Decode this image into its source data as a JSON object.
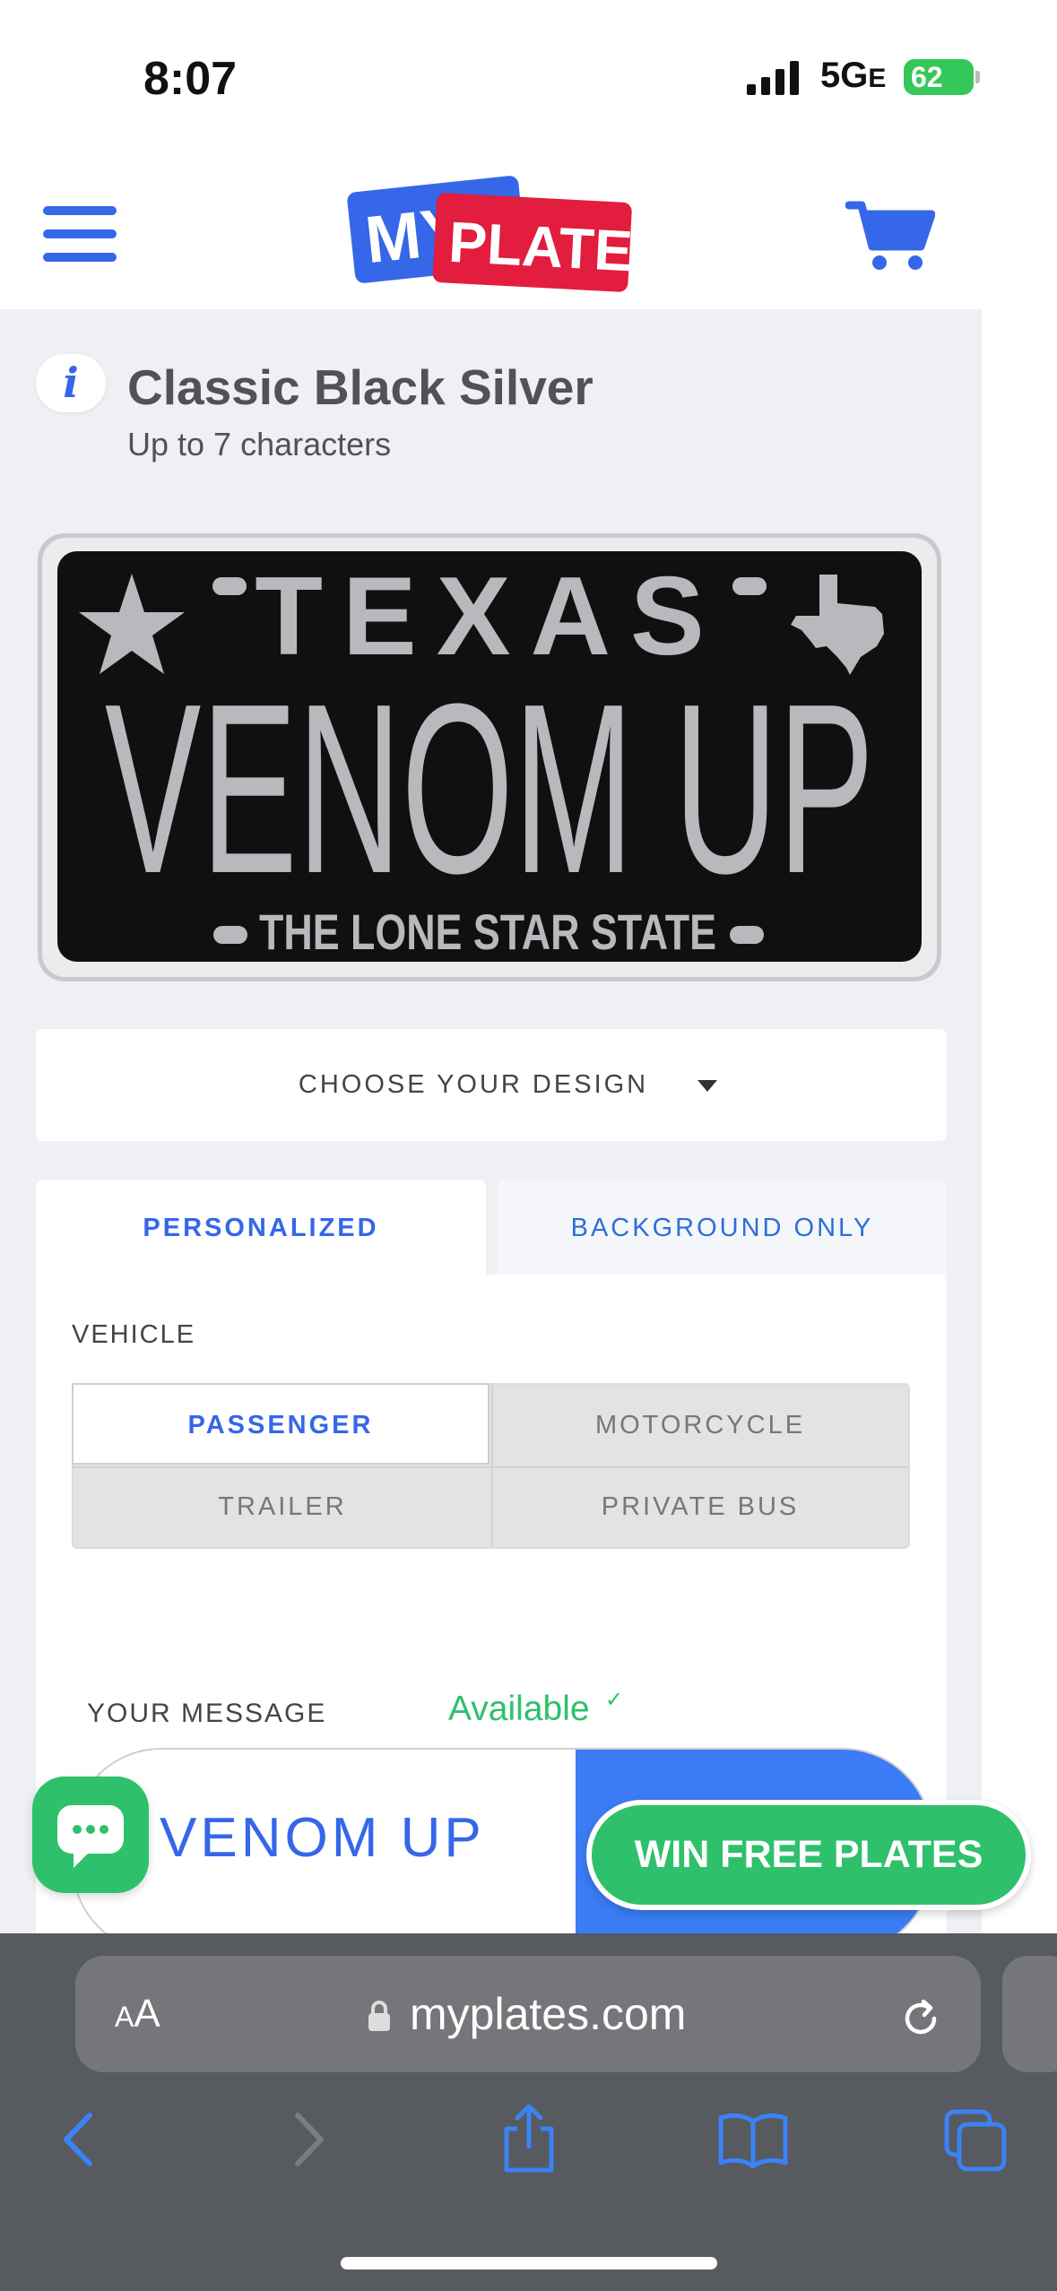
{
  "status_bar": {
    "time": "8:07",
    "network": "5G",
    "network_suffix": "E",
    "battery": "62"
  },
  "header": {
    "logo_left": "MY",
    "logo_right": "PLATES",
    "menu_icon": "hamburger-icon",
    "cart_icon": "cart-icon"
  },
  "design": {
    "title": "Classic Black Silver",
    "subtitle": "Up to 7 characters",
    "info_glyph": "i"
  },
  "plate": {
    "state": "TEXAS",
    "message": "VENOM UP",
    "slogan": "THE LONE STAR STATE",
    "colors": {
      "background": "#101010",
      "text": "#b8b9bd",
      "frame": "#d9dadc"
    }
  },
  "choose_design": {
    "label": "CHOOSE YOUR DESIGN"
  },
  "tabs": [
    {
      "label": "PERSONALIZED",
      "active": true
    },
    {
      "label": "BACKGROUND ONLY",
      "active": false
    }
  ],
  "vehicle": {
    "label": "VEHICLE",
    "options": [
      {
        "label": "PASSENGER",
        "selected": true
      },
      {
        "label": "MOTORCYCLE",
        "selected": false
      },
      {
        "label": "TRAILER",
        "selected": false
      },
      {
        "label": "PRIVATE BUS",
        "selected": false
      }
    ]
  },
  "message": {
    "label": "YOUR MESSAGE",
    "status": "Available",
    "value": "VENOM UP"
  },
  "chat": {
    "icon": "chat-bubble-icon"
  },
  "promo": {
    "label": "WIN FREE PLATES"
  },
  "browser": {
    "aa_small": "A",
    "aa_large": "A",
    "url": "myplates.com"
  },
  "colors": {
    "accent": "#3567e8",
    "success": "#2fc06c",
    "page_bg": "#eef0f4"
  }
}
